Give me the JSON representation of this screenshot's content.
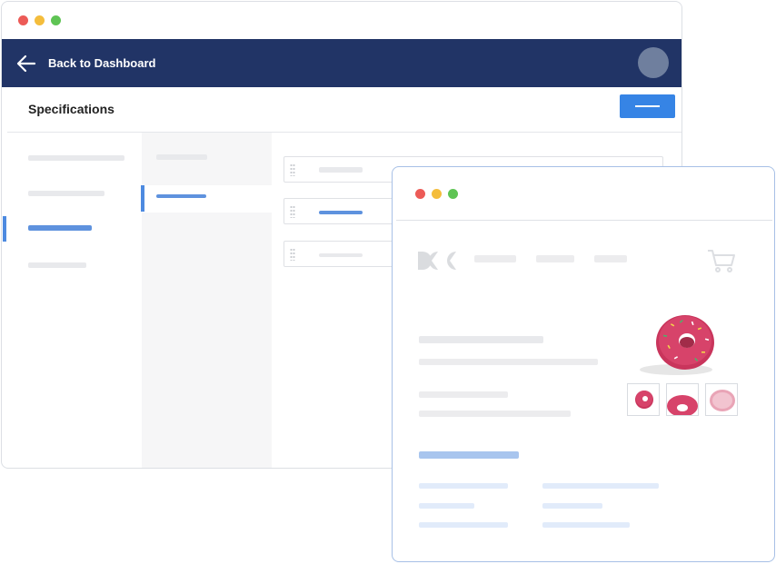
{
  "back_window": {
    "header": {
      "back_label": "Back to Dashboard"
    },
    "page": {
      "title": "Specifications"
    }
  },
  "front_window": {
    "product_name": "",
    "thumbnails": [
      "donut-thumb-1",
      "donut-thumb-2",
      "donut-thumb-3"
    ]
  },
  "colors": {
    "header_bg": "#213466",
    "accent": "#3684e5",
    "active_indicator": "#4d8ae0",
    "front_border": "#a7c0e6",
    "donut_frosting": "#d7436a"
  },
  "icons": {
    "back": "arrow-left-icon",
    "cart": "cart-icon",
    "logo": "brand-logo"
  }
}
